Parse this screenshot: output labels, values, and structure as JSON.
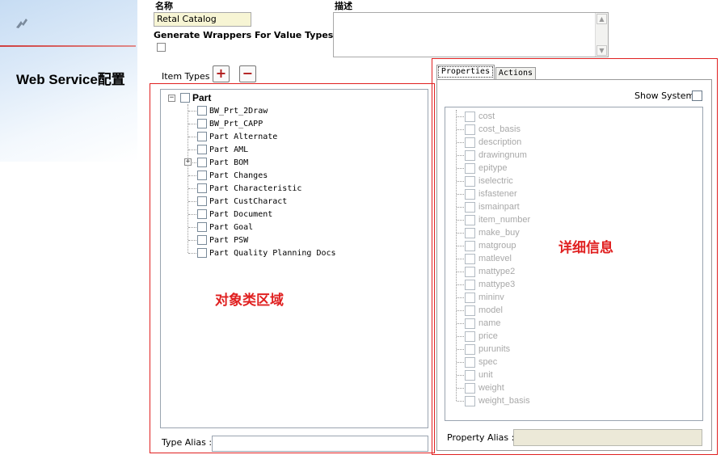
{
  "page_title": "Web Service配置",
  "form": {
    "name_label": "名称",
    "name_value": "Retal Catalog",
    "wrappers_label": "Generate Wrappers For Value Types",
    "description_label": "描述"
  },
  "item_types": {
    "label": "Item Types",
    "add_symbol": "+",
    "remove_symbol": "−",
    "root": "Part",
    "root_expander": "−",
    "children": [
      {
        "label": "BW_Prt_2Draw",
        "expandable": false
      },
      {
        "label": "BW_Prt_CAPP",
        "expandable": false
      },
      {
        "label": "Part Alternate",
        "expandable": false
      },
      {
        "label": "Part AML",
        "expandable": false
      },
      {
        "label": "Part BOM",
        "expandable": true
      },
      {
        "label": "Part Changes",
        "expandable": false
      },
      {
        "label": "Part Characteristic",
        "expandable": false
      },
      {
        "label": "Part CustCharact",
        "expandable": false
      },
      {
        "label": "Part Document",
        "expandable": false
      },
      {
        "label": "Part Goal",
        "expandable": false
      },
      {
        "label": "Part PSW",
        "expandable": false
      },
      {
        "label": "Part Quality Planning Docs",
        "expandable": false
      }
    ],
    "child_expander": "+",
    "annotation": "对象类区域",
    "type_alias_label": "Type Alias :"
  },
  "details": {
    "tabs": [
      {
        "label": "Properties",
        "active": true
      },
      {
        "label": "Actions",
        "active": false
      }
    ],
    "show_system_label": "Show System",
    "properties": [
      "cost",
      "cost_basis",
      "description",
      "drawingnum",
      "epitype",
      "iselectric",
      "isfastener",
      "ismainpart",
      "item_number",
      "make_buy",
      "matgroup",
      "matlevel",
      "mattype2",
      "mattype3",
      "mininv",
      "model",
      "name",
      "price",
      "purunits",
      "spec",
      "unit",
      "weight",
      "weight_basis"
    ],
    "annotation": "详细信息",
    "property_alias_label": "Property Alias :"
  },
  "colors": {
    "annotation": "#e02020",
    "name_field_bg": "#f7f5d4",
    "button_symbol": "#b01818"
  },
  "icons": [
    "app-logo-icon",
    "scroll-up-icon",
    "scroll-down-icon"
  ]
}
